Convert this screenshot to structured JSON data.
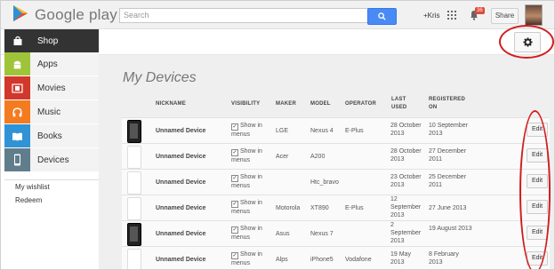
{
  "header": {
    "logo_text": "Google play",
    "search_placeholder": "Search",
    "user_link": "+Kris",
    "notification_count": "36",
    "share_label": "Share"
  },
  "sidebar": {
    "items": [
      {
        "label": "Shop",
        "icon": "shopping-bag-icon",
        "color": "#333333"
      },
      {
        "label": "Apps",
        "icon": "android-icon",
        "color": "#9fc43a"
      },
      {
        "label": "Movies",
        "icon": "film-icon",
        "color": "#d2372c"
      },
      {
        "label": "Music",
        "icon": "headphones-icon",
        "color": "#f47b20"
      },
      {
        "label": "Books",
        "icon": "book-icon",
        "color": "#2f93d6"
      },
      {
        "label": "Devices",
        "icon": "phone-icon",
        "color": "#607d8b"
      }
    ],
    "links": [
      "My wishlist",
      "Redeem"
    ]
  },
  "main": {
    "title": "My Devices",
    "columns": [
      "NICKNAME",
      "VISIBILITY",
      "MAKER",
      "MODEL",
      "OPERATOR",
      "LAST USED",
      "REGISTERED ON"
    ],
    "rows": [
      {
        "nickname": "Unnamed Device",
        "visibility": "Show in menus",
        "maker": "LGE",
        "model": "Nexus 4",
        "operator": "E-Plus",
        "last_used": "28 October 2013",
        "registered": "10 September 2013",
        "edit": "Edit",
        "thumb": "dark"
      },
      {
        "nickname": "Unnamed Device",
        "visibility": "Show in menus",
        "maker": "Acer",
        "model": "A200",
        "operator": "",
        "last_used": "28 October 2013",
        "registered": "27 December 2011",
        "edit": "Edit",
        "thumb": "light"
      },
      {
        "nickname": "Unnamed Device",
        "visibility": "Show in menus",
        "maker": "",
        "model": "Htc_bravo",
        "operator": "",
        "last_used": "23 October 2013",
        "registered": "25 December 2011",
        "edit": "Edit",
        "thumb": "light"
      },
      {
        "nickname": "Unnamed Device",
        "visibility": "Show in menus",
        "maker": "Motorola",
        "model": "XT890",
        "operator": "E-Plus",
        "last_used": "12 September 2013",
        "registered": "27 June 2013",
        "edit": "Edit",
        "thumb": "light"
      },
      {
        "nickname": "Unnamed Device",
        "visibility": "Show in menus",
        "maker": "Asus",
        "model": "Nexus 7",
        "operator": "",
        "last_used": "2 September 2013",
        "registered": "19 August 2013",
        "edit": "Edit",
        "thumb": "dark"
      },
      {
        "nickname": "Unnamed Device",
        "visibility": "Show in menus",
        "maker": "Alps",
        "model": "iPhone5",
        "operator": "Vodafone",
        "last_used": "19 May 2013",
        "registered": "8 February 2013",
        "edit": "Edit",
        "thumb": "light"
      }
    ]
  },
  "colors": {
    "accent": "#4a8af4",
    "annotation": "#d21d1d",
    "badge": "#dd4b39"
  }
}
